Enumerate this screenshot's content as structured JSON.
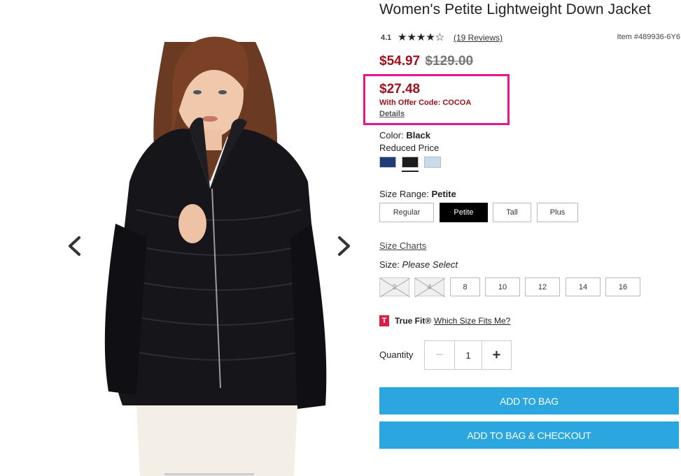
{
  "product": {
    "title": "Women's Petite Lightweight Down Jacket",
    "rating_value": "4.1",
    "rating_stars": "★★★★☆",
    "rating_fraction": 0.82,
    "reviews_link": "(19 Reviews)",
    "item_number": "Item #489936-6Y6"
  },
  "pricing": {
    "sale_price": "$54.97",
    "original_price": "$129.00",
    "offer_price": "$27.48",
    "offer_code_text": "With Offer Code: COCOA",
    "details_link": "Details",
    "highlight_color": "#e8168a",
    "sale_color": "#a0101c"
  },
  "color": {
    "label": "Color:",
    "selected": "Black",
    "note": "Reduced Price",
    "swatches": [
      {
        "name": "navy",
        "hex": "#1f3b7a"
      },
      {
        "name": "black",
        "hex": "#1c1c1f"
      },
      {
        "name": "light blue",
        "hex": "#c9dcee"
      }
    ]
  },
  "size_range": {
    "label": "Size Range:",
    "selected": "Petite",
    "options": [
      "Regular",
      "Petite",
      "Tall",
      "Plus"
    ]
  },
  "sizes": {
    "charts_link": "Size Charts",
    "label": "Size:",
    "prompt": "Please Select",
    "options": [
      "2",
      "4",
      "8",
      "10",
      "12",
      "14",
      "16"
    ],
    "unavailable": [
      "2",
      "4"
    ]
  },
  "truefit": {
    "logo": "T",
    "name": "True Fit®",
    "link": "Which Size Fits Me?"
  },
  "quantity": {
    "label": "Quantity",
    "value": "1",
    "minus": "−",
    "plus": "+"
  },
  "actions": {
    "add_to_bag": "ADD TO BAG",
    "add_to_bag_checkout": "ADD TO BAG & CHECKOUT",
    "button_color": "#2ba6de"
  },
  "gallery": {
    "prev_icon": "chevron-left-icon",
    "next_icon": "chevron-right-icon"
  }
}
